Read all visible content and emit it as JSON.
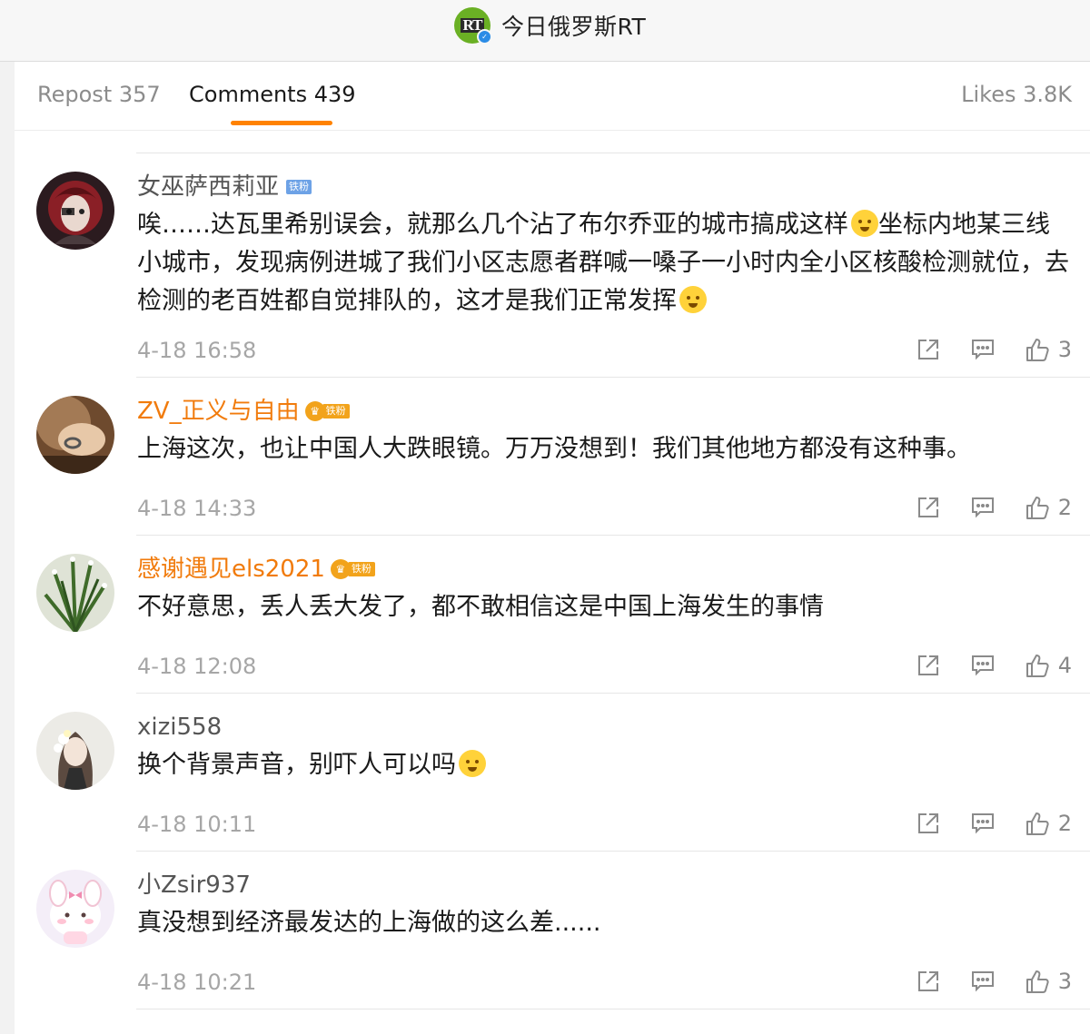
{
  "header": {
    "logo_text": "RT",
    "title": "今日俄罗斯RT"
  },
  "tabs": {
    "repost": "Repost 357",
    "comments": "Comments 439",
    "likes": "Likes 3.8K"
  },
  "colors": {
    "accent": "#ff8200",
    "fan_name": "#f17b0c",
    "timestamp": "#a6a6a6"
  },
  "comments": [
    {
      "user": "女巫萨西莉亚",
      "badge": "铁粉",
      "badge_style": "plain",
      "lines": [
        "唉……达瓦里希别误会，就那么几个沾了布尔乔亚的城市搞成这样",
        "坐标内地某三线小城市，发现病例进城了我们小区志愿者群喊一嗓子一小时内全小区核酸检测就位，去检测的老百姓都自觉排队的，这才是我们正常发挥"
      ],
      "time": "4-18 16:58",
      "likes": "3"
    },
    {
      "user": "ZV_正义与自由",
      "badge": "铁粉",
      "badge_style": "gold",
      "lines": [
        "上海这次，也让中国人大跌眼镜。万万没想到！我们其他地方都没有这种事。"
      ],
      "time": "4-18 14:33",
      "likes": "2"
    },
    {
      "user": "感谢遇见els2021",
      "badge": "铁粉",
      "badge_style": "gold",
      "lines": [
        "不好意思，丢人丢大发了，都不敢相信这是中国上海发生的事情"
      ],
      "time": "4-18 12:08",
      "likes": "4"
    },
    {
      "user": "xizi558",
      "badge": "",
      "badge_style": "none",
      "lines": [
        "换个背景声音，别吓人可以吗"
      ],
      "time": "4-18 10:11",
      "likes": "2"
    },
    {
      "user": "小Zsir937",
      "badge": "",
      "badge_style": "none",
      "lines": [
        "真没想到经济最发达的上海做的这么差......"
      ],
      "time": "4-18 10:21",
      "likes": "3"
    }
  ]
}
